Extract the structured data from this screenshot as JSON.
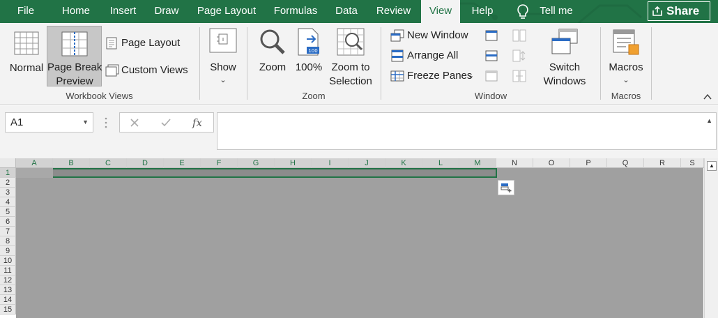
{
  "tabs": [
    {
      "label": "File"
    },
    {
      "label": "Home"
    },
    {
      "label": "Insert"
    },
    {
      "label": "Draw"
    },
    {
      "label": "Page Layout"
    },
    {
      "label": "Formulas"
    },
    {
      "label": "Data"
    },
    {
      "label": "Review"
    },
    {
      "label": "View"
    },
    {
      "label": "Help"
    }
  ],
  "tell_me": "Tell me",
  "share_label": "Share",
  "ribbon": {
    "workbook_views": {
      "normal": "Normal",
      "page_break_line1": "Page Break",
      "page_break_line2": "Preview",
      "page_layout": "Page Layout",
      "custom_views": "Custom Views",
      "label": "Workbook Views"
    },
    "show": {
      "label": "Show"
    },
    "zoom": {
      "zoom": "Zoom",
      "hundred": "100%",
      "zoom_sel_line1": "Zoom to",
      "zoom_sel_line2": "Selection",
      "label": "Zoom"
    },
    "window": {
      "new_window": "New Window",
      "arrange_all": "Arrange All",
      "freeze_panes": "Freeze Panes",
      "switch_line1": "Switch",
      "switch_line2": "Windows",
      "label": "Window"
    },
    "macros": {
      "macros": "Macros",
      "label": "Macros"
    },
    "accent_color": "#217346"
  },
  "formula_bar": {
    "name_box": "A1",
    "formula_value": ""
  },
  "grid": {
    "columns": [
      "A",
      "B",
      "C",
      "D",
      "E",
      "F",
      "G",
      "H",
      "I",
      "J",
      "K",
      "L",
      "M",
      "N",
      "O",
      "P",
      "Q",
      "R",
      "S"
    ],
    "rows": [
      "1",
      "2",
      "3",
      "4",
      "5",
      "6",
      "7",
      "8",
      "9",
      "10",
      "11",
      "12",
      "13",
      "14",
      "15"
    ]
  }
}
